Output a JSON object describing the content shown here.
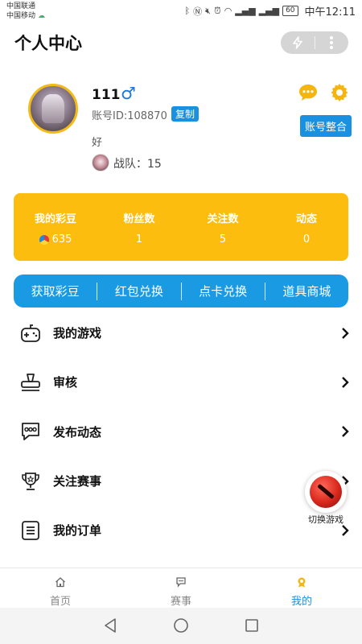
{
  "status_bar": {
    "carrier1": "中国联通",
    "carrier2": "中国移动",
    "battery": "60",
    "time": "中午12:11"
  },
  "header": {
    "title": "个人中心"
  },
  "profile": {
    "username": "111",
    "gender": "male",
    "account_id": "账号ID:108870",
    "copy_label": "复制",
    "bio": "好",
    "team": "战队：15",
    "merge_label": "账号整合"
  },
  "stats": [
    {
      "label": "我的彩豆",
      "value": "635"
    },
    {
      "label": "粉丝数",
      "value": "1"
    },
    {
      "label": "关注数",
      "value": "5"
    },
    {
      "label": "动态",
      "value": "0"
    }
  ],
  "actions": [
    "获取彩豆",
    "红包兑换",
    "点卡兑换",
    "道具商城"
  ],
  "menu": [
    {
      "label": "我的游戏",
      "icon": "gamepad-icon"
    },
    {
      "label": "审核",
      "icon": "stamp-icon"
    },
    {
      "label": "发布动态",
      "icon": "chat-bubble-icon"
    },
    {
      "label": "关注赛事",
      "icon": "trophy-icon"
    },
    {
      "label": "我的订单",
      "icon": "order-list-icon"
    }
  ],
  "fab": {
    "label": "切换游戏"
  },
  "tabs": [
    {
      "label": "首页",
      "icon": "home-icon",
      "active": false
    },
    {
      "label": "赛事",
      "icon": "match-icon",
      "active": false
    },
    {
      "label": "我的",
      "icon": "profile-icon",
      "active": true
    }
  ],
  "colors": {
    "accent_blue": "#1a90e0",
    "stats_yellow": "#fcbd0f",
    "action_blue": "#1a9ae3"
  }
}
